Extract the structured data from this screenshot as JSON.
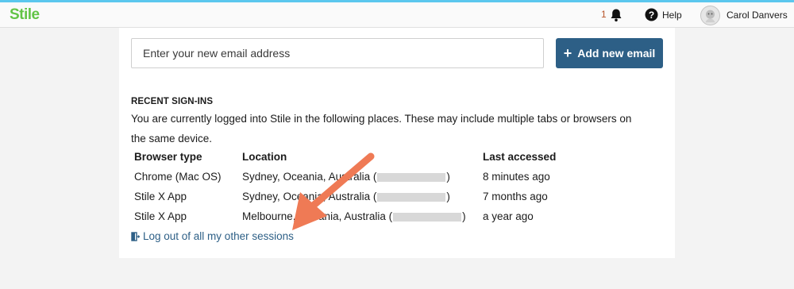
{
  "header": {
    "logo": "Stile",
    "notification_count": "1",
    "help_label": "Help",
    "user_name": "Carol Danvers"
  },
  "email": {
    "placeholder": "Enter your new email address",
    "add_button_label": "Add new email"
  },
  "recent_signins": {
    "title": "RECENT SIGN-INS",
    "description": "You are currently logged into Stile in the following places. These may include multiple tabs or browsers on the same device.",
    "columns": [
      "Browser type",
      "Location",
      "Last accessed"
    ],
    "rows": [
      {
        "browser": "Chrome (Mac OS)",
        "location_prefix": "Sydney, Oceania, Australia (",
        "location_suffix": ")",
        "last_accessed": "8 minutes ago"
      },
      {
        "browser": "Stile X App",
        "location_prefix": "Sydney, Oceania, Australia (",
        "location_suffix": ")",
        "last_accessed": "7 months ago"
      },
      {
        "browser": "Stile X App",
        "location_prefix": "Melbourne, Oceania, Australia (",
        "location_suffix": ")",
        "last_accessed": "a year ago"
      }
    ],
    "logout_label": "Log out of all my other sessions"
  },
  "colors": {
    "brand_green": "#62c446",
    "primary_button": "#2d5f86",
    "link": "#2d5f86",
    "annotation_arrow": "#ef7a55"
  },
  "icons": [
    "bell-icon",
    "help-icon",
    "avatar",
    "plus-icon",
    "logout-icon",
    "annotation-arrow"
  ]
}
